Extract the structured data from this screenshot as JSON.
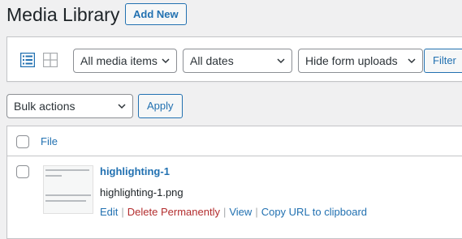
{
  "header": {
    "title": "Media Library",
    "add_new_label": "Add New"
  },
  "filters": {
    "media_type": "All media items",
    "dates": "All dates",
    "form_uploads": "Hide form uploads",
    "filter_label": "Filter"
  },
  "bulk": {
    "actions_label": "Bulk actions",
    "apply_label": "Apply"
  },
  "table": {
    "column_file": "File",
    "rows": [
      {
        "title": "highlighting-1",
        "filename": "highlighting-1.png",
        "actions": {
          "edit": "Edit",
          "delete": "Delete Permanently",
          "view": "View",
          "copy": "Copy URL to clipboard"
        }
      }
    ]
  },
  "colors": {
    "accent": "#2271b1",
    "danger": "#b32d2e",
    "background": "#f0f0f1"
  },
  "icons": {
    "list_view": "list-view-icon",
    "grid_view": "grid-view-icon",
    "dropdown": "chevron-down-icon"
  }
}
